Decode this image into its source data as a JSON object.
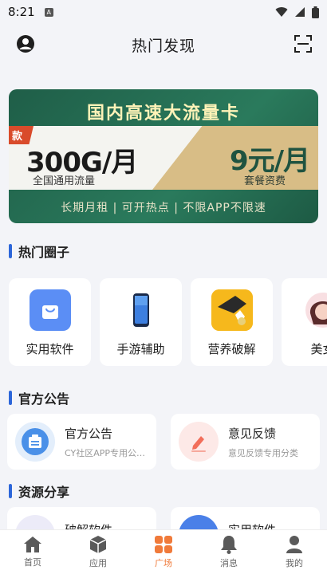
{
  "status": {
    "time": "8:21"
  },
  "header": {
    "title": "热门发现"
  },
  "banner": {
    "title": "国内高速大流量卡",
    "tag": "款",
    "left_big": "300G/月",
    "left_small": "全国通用流量",
    "right_big": "9元/月",
    "right_small": "套餐资费",
    "bottom": "长期月租 | 可开热点 | 不限APP不限速"
  },
  "sections": {
    "hot_circles": "热门圈子",
    "notices": "官方公告",
    "resources": "资源分享"
  },
  "circles": [
    {
      "name": "实用软件",
      "icon": "shopping-bag-icon"
    },
    {
      "name": "手游辅助",
      "icon": "phone-icon"
    },
    {
      "name": "营养破解",
      "icon": "game-art-icon"
    },
    {
      "name": "美女",
      "icon": "girl-avatar-icon"
    }
  ],
  "notices": [
    {
      "title": "官方公告",
      "desc": "CY社区APP专用公…",
      "icon": "notice-icon"
    },
    {
      "title": "意见反馈",
      "desc": "意见反馈专用分类",
      "icon": "edit-icon"
    }
  ],
  "resources": [
    {
      "title": "破解软件"
    },
    {
      "title": "实用软件"
    }
  ],
  "tabs": [
    {
      "label": "首页",
      "icon": "home-icon"
    },
    {
      "label": "应用",
      "icon": "cube-icon"
    },
    {
      "label": "广场",
      "icon": "grid-icon",
      "active": true
    },
    {
      "label": "消息",
      "icon": "bell-icon"
    },
    {
      "label": "我的",
      "icon": "person-icon"
    }
  ],
  "colors": {
    "accent": "#f07a3a",
    "section_bar": "#2c66d9",
    "banner_green": "#1f5e48"
  }
}
